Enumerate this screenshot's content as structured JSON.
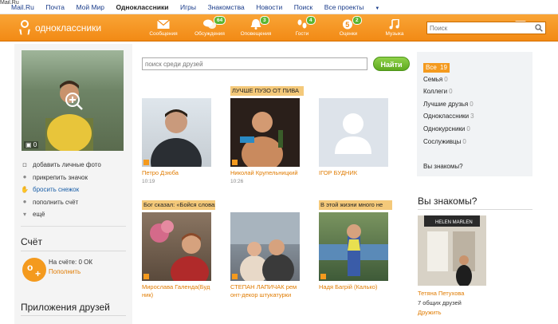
{
  "watermark": "Mail.Ru",
  "portal": {
    "links": [
      "Mail.Ru",
      "Почта",
      "Мой Мир",
      "Одноклассники",
      "Игры",
      "Знакомства",
      "Новости",
      "Поиск",
      "Все проекты"
    ]
  },
  "header": {
    "logo_text": "одноклассники",
    "nav": [
      {
        "label": "Сообщения",
        "icon": "envelope-icon",
        "badge": ""
      },
      {
        "label": "Обсуждения",
        "icon": "chat-bubbles-icon",
        "badge": "64"
      },
      {
        "label": "Оповещения",
        "icon": "bell-icon",
        "badge": "3"
      },
      {
        "label": "Гости",
        "icon": "footprints-icon",
        "badge": "4"
      },
      {
        "label": "Оценки",
        "icon": "rating-five-icon",
        "badge": "2"
      },
      {
        "label": "Музыка",
        "icon": "music-note-icon",
        "badge": ""
      }
    ],
    "search_placeholder": "Поиск"
  },
  "profile": {
    "photo_count": "0",
    "actions": [
      {
        "label": "добавить личные фото",
        "icon": "camera-icon"
      },
      {
        "label": "прикрепить значок",
        "icon": "pin-icon"
      },
      {
        "label": "бросить снежок",
        "icon": "hand-icon"
      },
      {
        "label": "пополнить счёт",
        "icon": "coin-icon"
      },
      {
        "label": "ещё",
        "icon": "chevron-down-icon"
      }
    ],
    "account_title": "Счёт",
    "account_text": "На счёте: 0 ОК",
    "account_link": "Пополнить",
    "apps_title": "Приложения друзей"
  },
  "friends_search": {
    "placeholder": "поиск среди друзей",
    "button": "Найти"
  },
  "friends": [
    {
      "status": "",
      "name": "Петро Дзюба",
      "name2": "",
      "time": "10:19"
    },
    {
      "status": "ЛУЧШЕ ПУЗО ОТ ПИВА",
      "name": "Николай Крупельницкий",
      "name2": "",
      "time": "10:26"
    },
    {
      "status": "",
      "name": "ІГОР БУДНИК",
      "name2": "",
      "time": ""
    },
    {
      "status": "Бог сказал: «Бойся слова»",
      "name": "Мирослава Галенда(Буд",
      "name2": "ник)",
      "time": ""
    },
    {
      "status": "",
      "name": "СТЕПАН ЛАПИЧАК рем",
      "name2": "онт-декор штукатурки",
      "time": ""
    },
    {
      "status": "В этой жизни много не",
      "name": "Надя Багрій (Калько)",
      "name2": "",
      "time": ""
    }
  ],
  "groups": [
    {
      "label": "Все",
      "count": "19"
    },
    {
      "label": "Семья",
      "count": "0"
    },
    {
      "label": "Коллеги",
      "count": "0"
    },
    {
      "label": "Лучшие друзья",
      "count": "0"
    },
    {
      "label": "Одноклассники",
      "count": "3"
    },
    {
      "label": "Однокурсники",
      "count": "0"
    },
    {
      "label": "Сослуживцы",
      "count": "0"
    }
  ],
  "groups_know": "Вы знакомы?",
  "suggest": {
    "title": "Вы знакомы?",
    "name": "Тетяна Петухова",
    "mutual": "7 общих друзей",
    "link": "Дружить",
    "sign_text": "HELEN MARLEN"
  },
  "colors": {
    "accent": "#f28a15",
    "link_orange": "#e07b00",
    "badge_green": "#5bb630",
    "status_bg": "#f4c97a"
  }
}
